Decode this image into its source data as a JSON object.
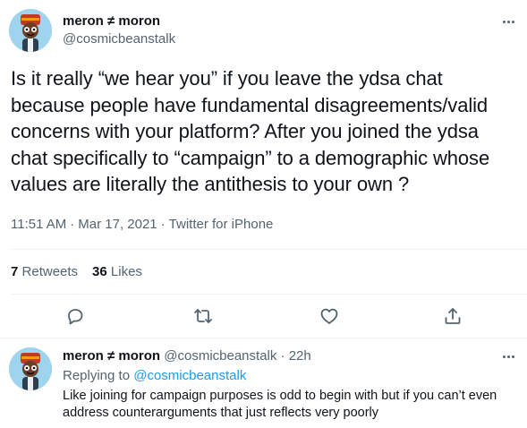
{
  "main_tweet": {
    "author_name": "meron ≠ moron",
    "author_handle": "@cosmicbeanstalk",
    "text": "Is it really “we hear you” if you leave the ydsa chat because people have fundamental disagreements/valid concerns with your platform? After you joined the ydsa chat specifically to “campaign” to a demographic whose values are literally the antithesis to your own ?",
    "time": "11:51 AM",
    "separator": "·",
    "date": "Mar 17, 2021",
    "source": "Twitter for iPhone",
    "retweets_count": "7",
    "retweets_label": "Retweets",
    "likes_count": "36",
    "likes_label": "Likes",
    "actions": [
      "reply-icon",
      "retweet-icon",
      "like-icon",
      "share-icon"
    ]
  },
  "reply_tweet": {
    "author_name": "meron ≠ moron",
    "author_handle": "@cosmicbeanstalk",
    "separator": "·",
    "time_ago": "22h",
    "replying_prefix": "Replying to",
    "replying_to": "@cosmicbeanstalk",
    "text": "Like joining for campaign purposes is odd to begin with but if you can’t even address counterarguments that just reflects very poorly"
  },
  "colors": {
    "text_primary": "#0f1419",
    "text_secondary": "#536471",
    "link": "#1d9bf0",
    "divider": "#eff3f4",
    "avatar_bg": "#9fd4ef"
  }
}
